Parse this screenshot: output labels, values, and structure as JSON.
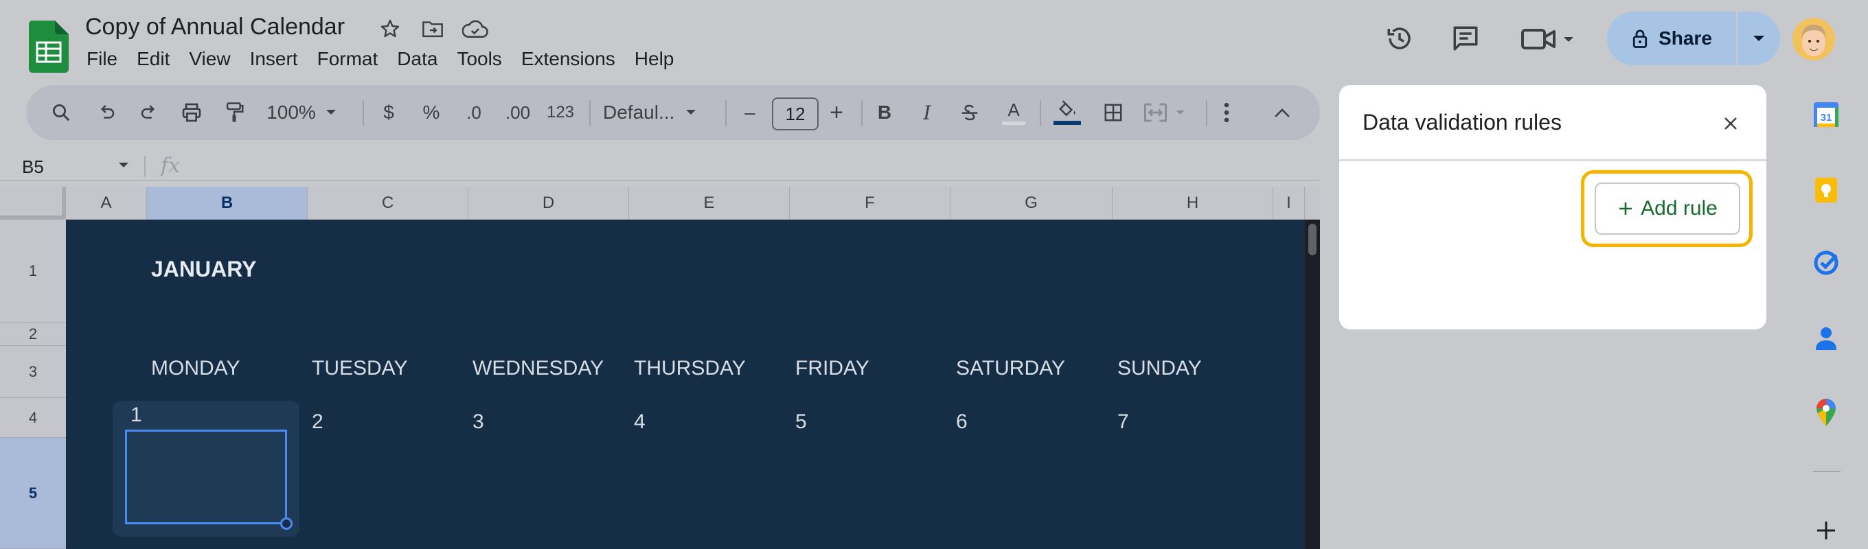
{
  "document": {
    "title": "Copy of Annual Calendar"
  },
  "menu": [
    "File",
    "Edit",
    "View",
    "Insert",
    "Format",
    "Data",
    "Tools",
    "Extensions",
    "Help"
  ],
  "share": {
    "label": "Share"
  },
  "toolbar": {
    "zoom": "100%",
    "currency": "$",
    "percent": "%",
    "decrease_decimal": ".0",
    "increase_decimal": ".00",
    "number_format": "123",
    "font": "Defaul...",
    "font_size": "12",
    "minus": "–",
    "plus": "+",
    "bold": "B",
    "italic": "I",
    "text_color": "A"
  },
  "formula_bar": {
    "cell_ref": "B5",
    "fx": "fx"
  },
  "grid": {
    "columns": [
      "A",
      "B",
      "C",
      "D",
      "E",
      "F",
      "G",
      "H",
      "I"
    ],
    "rows": [
      "1",
      "2",
      "3",
      "4",
      "5"
    ],
    "month": "JANUARY",
    "days": [
      "MONDAY",
      "TUESDAY",
      "WEDNESDAY",
      "THURSDAY",
      "FRIDAY",
      "SATURDAY",
      "SUNDAY"
    ],
    "dates": [
      "1",
      "2",
      "3",
      "4",
      "5",
      "6",
      "7"
    ]
  },
  "panel": {
    "title": "Data validation rules",
    "add_rule": "Add rule"
  },
  "sidebar": {
    "calendar_badge": "31"
  },
  "colors": {
    "sheet_bg": "#152d45",
    "selection": "#4a8af4",
    "highlight": "#f4b400",
    "add_rule_text": "#146c2e",
    "share_bg": "#a8c4e4"
  }
}
